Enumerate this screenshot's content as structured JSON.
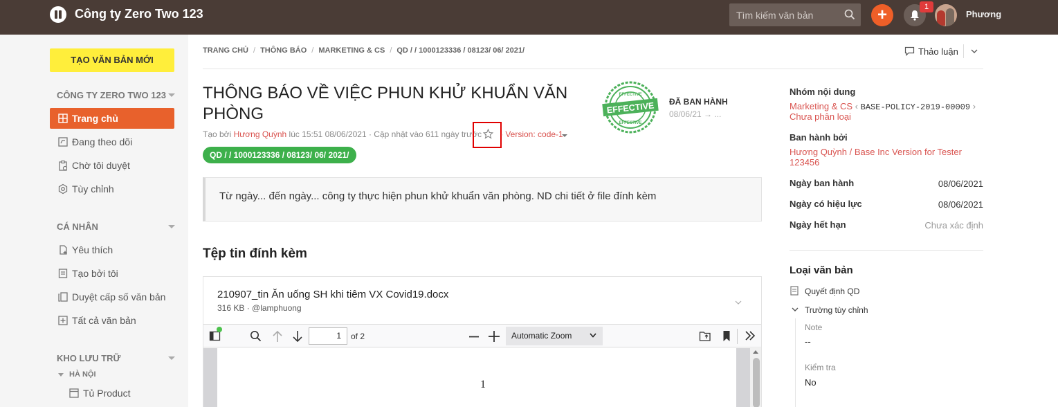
{
  "header": {
    "company": "Công ty Zero Two 123",
    "search_placeholder": "Tìm kiếm văn bản",
    "add_label": "+",
    "notification_count": "1",
    "username": "Phương"
  },
  "sidebar": {
    "new_doc_label": "TẠO VĂN BẢN MỚI",
    "company_section": "CÔNG TY ZERO TWO 123",
    "company_items": [
      {
        "label": "Trang chủ",
        "icon": "grid-icon"
      },
      {
        "label": "Đang theo dõi",
        "icon": "follow-icon"
      },
      {
        "label": "Chờ tôi duyệt",
        "icon": "clipboard-icon"
      },
      {
        "label": "Tùy chỉnh",
        "icon": "gear-icon"
      }
    ],
    "personal_section": "CÁ NHÂN",
    "personal_items": [
      {
        "label": "Yêu thích",
        "icon": "favorite-icon"
      },
      {
        "label": "Tạo bởi tôi",
        "icon": "document-icon"
      },
      {
        "label": "Duyệt cấp số văn bản",
        "icon": "stack-icon"
      },
      {
        "label": "Tất cả văn bản",
        "icon": "all-docs-icon"
      }
    ],
    "storage_section": "KHO LƯU TRỮ",
    "storage_sub": "HÀ NỘI",
    "storage_items": [
      {
        "label": "Tủ Product",
        "icon": "cabinet-icon"
      }
    ]
  },
  "breadcrumb": [
    "TRANG CHỦ",
    "THÔNG BÁO",
    "MARKETING & CS",
    "QD / / 1000123336 / 08123/ 06/ 2021/"
  ],
  "discuss_label": "Thảo luận",
  "document": {
    "title": "THÔNG BÁO VỀ VIỆC PHUN KHỬ KHUẨN VĂN PHÒNG",
    "meta_prefix": "Tạo bởi",
    "author": "Hương Quỳnh",
    "meta_suffix": "lúc 15:51 08/06/2021 · Cập nhật vào 611 ngày trước ·",
    "version": "· Version: code-1",
    "code": "QD / / 1000123336 / 08123/ 06/ 2021/",
    "stamp_text": "EFFECTIVE",
    "stamp_ring": "EFFECTIVE",
    "status": "ĐÃ BAN HÀNH",
    "status_date": "08/06/21 → ...",
    "description": "Từ ngày... đến ngày... công ty thực hiện phun khử khuẩn văn phòng. ND chi tiết ở file đính kèm"
  },
  "attachments": {
    "title": "Tệp tin đính kèm",
    "file_name": "210907_tin Ăn uống SH khi tiêm VX Covid19.docx",
    "file_meta": "316 KB · @lamphuong",
    "viewer": {
      "page": "1",
      "of_label": "of 2",
      "zoom": "Automatic Zoom",
      "page_number_text": "1"
    }
  },
  "right_panel": {
    "group_label": "Nhóm nội dung",
    "group_link": "Marketing & CS",
    "group_code": "BASE-POLICY-2019-00009",
    "group_sub": "Chưa phân loại",
    "issued_by_label": "Ban hành bởi",
    "issued_by": "Hương Quỳnh / Base Inc Version for Tester 123456",
    "issue_date_label": "Ngày ban hành",
    "issue_date": "08/06/2021",
    "effective_label": "Ngày có hiệu lực",
    "effective_date": "08/06/2021",
    "expiry_label": "Ngày hết hạn",
    "expiry_date": "Chưa xác định",
    "doc_type_title": "Loại văn bản",
    "doc_type": "Quyết định QD",
    "custom_fields_label": "Trường tùy chỉnh",
    "note_label": "Note",
    "note_value": "--",
    "check_label": "Kiểm tra",
    "check_value": "No"
  },
  "colors": {
    "topbar": "#4a3c36",
    "accent": "#e8612c",
    "new_doc": "#ffee3b",
    "link": "#d9534f",
    "effective": "#3db04b"
  }
}
